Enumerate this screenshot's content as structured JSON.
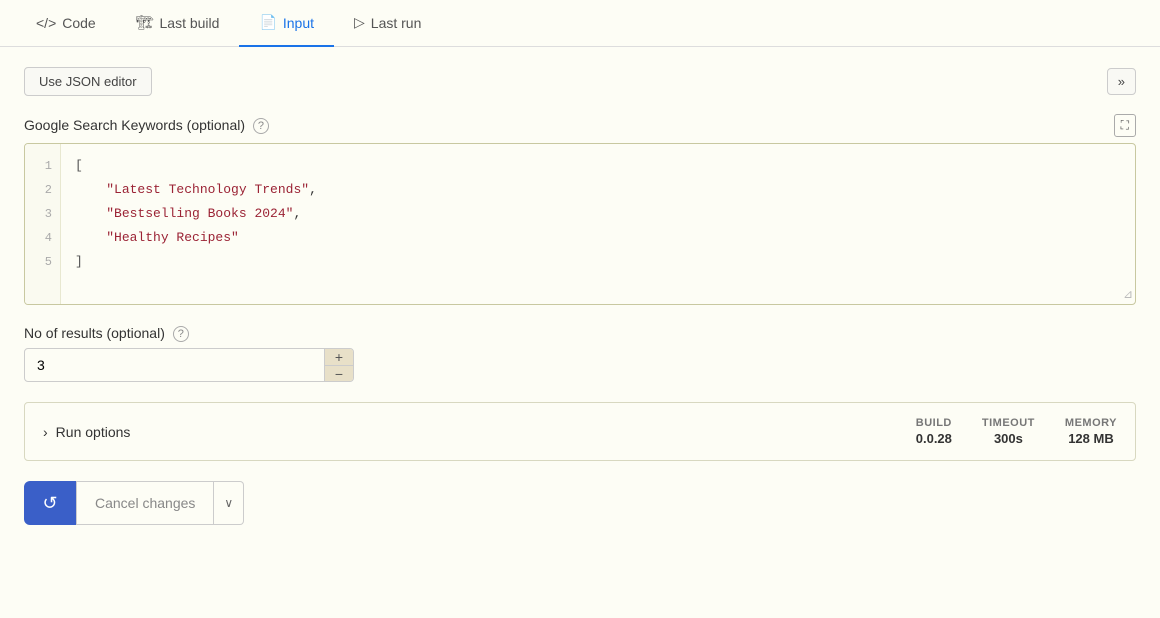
{
  "tabs": [
    {
      "id": "code",
      "label": "Code",
      "icon": "</>",
      "active": false
    },
    {
      "id": "last-build",
      "label": "Last build",
      "icon": "📦",
      "active": false
    },
    {
      "id": "input",
      "label": "Input",
      "icon": "📄",
      "active": true
    },
    {
      "id": "last-run",
      "label": "Last run",
      "icon": "▷",
      "active": false
    }
  ],
  "toolbar": {
    "json_editor_label": "Use JSON editor",
    "expand_icon": "»"
  },
  "keywords_field": {
    "label": "Google Search Keywords",
    "optional_text": "(optional)",
    "help_tooltip": "?",
    "fullscreen_icon": "⛶",
    "code_lines": [
      {
        "num": "1",
        "content": "["
      },
      {
        "num": "2",
        "content": "    \"Latest Technology Trends\","
      },
      {
        "num": "3",
        "content": "    \"Bestselling Books 2024\","
      },
      {
        "num": "4",
        "content": "    \"Healthy Recipes\""
      },
      {
        "num": "5",
        "content": "]"
      }
    ]
  },
  "results_field": {
    "label": "No of results",
    "optional_text": "(optional)",
    "help_tooltip": "?",
    "value": "3",
    "stepper_up": "+",
    "stepper_down": "−"
  },
  "run_options": {
    "label": "Run options",
    "chevron": "›",
    "stats": [
      {
        "label": "BUILD",
        "value": "0.0.28"
      },
      {
        "label": "TIMEOUT",
        "value": "300s"
      },
      {
        "label": "MEMORY",
        "value": "128 MB"
      }
    ]
  },
  "bottom_bar": {
    "run_icon": "↺",
    "cancel_label": "Cancel changes",
    "dropdown_icon": "∨"
  }
}
